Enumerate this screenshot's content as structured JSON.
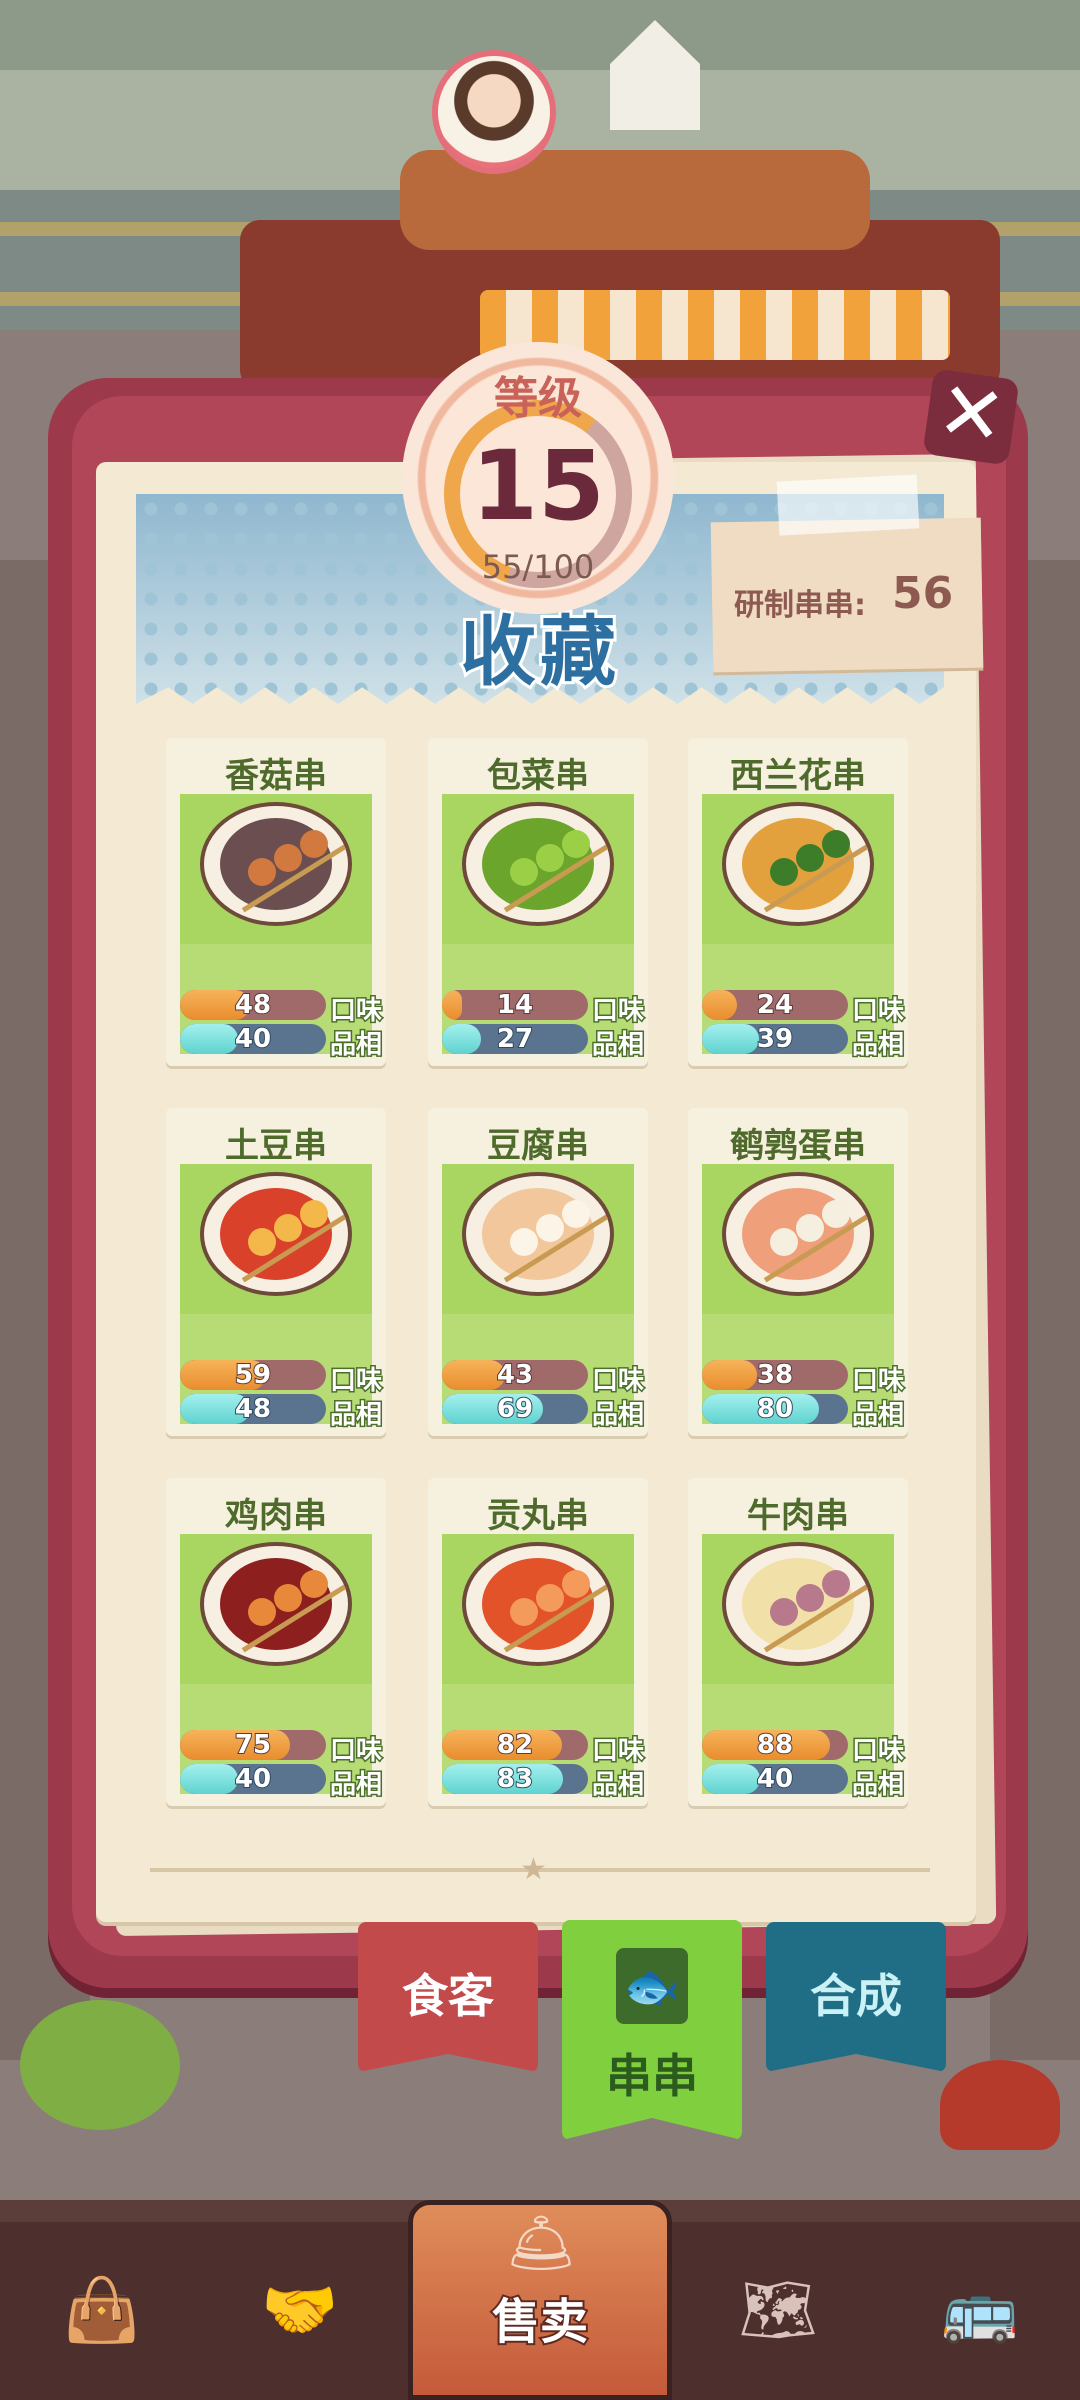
{
  "level": {
    "label": "等级",
    "value": "15",
    "progress_text": "55/100",
    "progress_fraction": 0.55
  },
  "banner": {
    "title": "收藏"
  },
  "research": {
    "label": "研制串串:",
    "value": "56"
  },
  "close_icon": "close-icon",
  "stat_labels": {
    "taste": "口味",
    "quality": "品相"
  },
  "items": [
    {
      "name": "香菇串",
      "taste": "48",
      "quality": "40",
      "taste_fill": 0.48,
      "quality_fill": 0.4,
      "sauce": "#6b4e4f",
      "ball": "#d1793f"
    },
    {
      "name": "包菜串",
      "taste": "14",
      "quality": "27",
      "taste_fill": 0.14,
      "quality_fill": 0.27,
      "sauce": "#6ca52b",
      "ball": "#9bd046"
    },
    {
      "name": "西兰花串",
      "taste": "24",
      "quality": "39",
      "taste_fill": 0.24,
      "quality_fill": 0.39,
      "sauce": "#e3a13d",
      "ball": "#3d7d29"
    },
    {
      "name": "土豆串",
      "taste": "59",
      "quality": "48",
      "taste_fill": 0.59,
      "quality_fill": 0.48,
      "sauce": "#d9412a",
      "ball": "#f3b74a"
    },
    {
      "name": "豆腐串",
      "taste": "43",
      "quality": "69",
      "taste_fill": 0.43,
      "quality_fill": 0.69,
      "sauce": "#f2c79b",
      "ball": "#fbf4e7"
    },
    {
      "name": "鹌鹑蛋串",
      "taste": "38",
      "quality": "80",
      "taste_fill": 0.38,
      "quality_fill": 0.8,
      "sauce": "#efa07b",
      "ball": "#f5efe0"
    },
    {
      "name": "鸡肉串",
      "taste": "75",
      "quality": "40",
      "taste_fill": 0.75,
      "quality_fill": 0.4,
      "sauce": "#8d1f1f",
      "ball": "#e7883b"
    },
    {
      "name": "贡丸串",
      "taste": "82",
      "quality": "83",
      "taste_fill": 0.82,
      "quality_fill": 0.83,
      "sauce": "#e2532a",
      "ball": "#f49a5b"
    },
    {
      "name": "牛肉串",
      "taste": "88",
      "quality": "40",
      "taste_fill": 0.88,
      "quality_fill": 0.4,
      "sauce": "#f1e0a8",
      "ball": "#b9798c"
    }
  ],
  "tabs": [
    {
      "label": "食客",
      "active": false
    },
    {
      "label": "串串",
      "active": true,
      "icon": "fish-book-icon"
    },
    {
      "label": "合成",
      "active": false
    }
  ],
  "nav": {
    "items": [
      {
        "icon": "bag-icon",
        "glyph": "👜"
      },
      {
        "icon": "handshake-icon",
        "glyph": "🤝"
      },
      {
        "icon": "sell-bell-icon",
        "glyph": "🛎"
      },
      {
        "icon": "map-icon",
        "glyph": "🗺"
      },
      {
        "icon": "bus-icon",
        "glyph": "🚌"
      }
    ],
    "sell_label": "售卖"
  }
}
